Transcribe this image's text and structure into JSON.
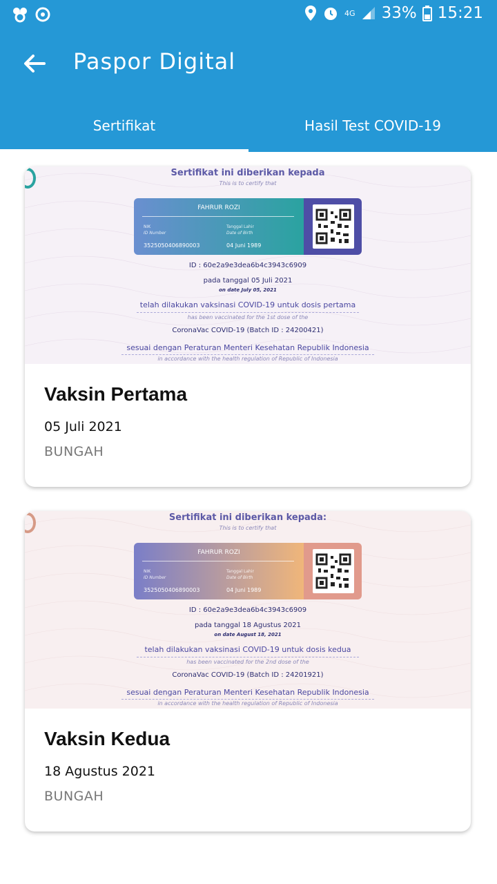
{
  "status_bar": {
    "battery": "33%",
    "time": "15:21",
    "network": "4G",
    "icons": [
      "app-notification-icon",
      "app-notification-icon-2",
      "location-icon",
      "alarm-icon",
      "signal-icon",
      "battery-icon"
    ]
  },
  "app_bar": {
    "title": "Paspor Digital"
  },
  "tabs": [
    {
      "label": "Sertifikat",
      "selected": true
    },
    {
      "label": "Hasil Test COVID-19",
      "selected": false
    }
  ],
  "colors": {
    "primary": "#2598d6",
    "card1_grad_start": "#6a8fd0",
    "card1_grad_end": "#2aa3a0",
    "card1_qr_bg": "#4e4ea6",
    "card2_grad_start": "#7a7ec8",
    "card2_grad_end": "#f0b67a",
    "card2_qr_bg": "#e19a8c"
  },
  "certificates": [
    {
      "cert_title": "Sertifikat ini diberikan kepada",
      "cert_title_en": "This is to certify that",
      "name": "FAHRUR ROZI",
      "nik_label": "NIK",
      "nik_label_en": "ID Number",
      "nik": "3525050406890003",
      "dob_label": "Tanggal Lahir",
      "dob_label_en": "Date of Birth",
      "dob": "04 Juni 1989",
      "id_line": "ID : 60e2a9e3dea6b4c3943c6909",
      "date_line": "pada tanggal 05 Juli 2021",
      "date_line_en": "on date July 05, 2021",
      "vacc_line": "telah dilakukan vaksinasi COVID-19 untuk dosis pertama",
      "vacc_line_en": "has been vaccinated for the 1st dose of the",
      "batch_line": "CoronaVac COVID-19 (Batch ID : 24200421)",
      "regulation": "sesuai dengan Peraturan Menteri Kesehatan Republik Indonesia",
      "regulation_en": "in accordance with the health regulation of Republic of Indonesia",
      "title": "Vaksin Pertama",
      "date": "05 Juli 2021",
      "location": "BUNGAH"
    },
    {
      "cert_title": "Sertifikat ini diberikan kepada:",
      "cert_title_en": "This is to certify that",
      "name": "FAHRUR ROZI",
      "nik_label": "NIK",
      "nik_label_en": "ID Number",
      "nik": "3525050406890003",
      "dob_label": "Tanggal Lahir",
      "dob_label_en": "Date of Birth",
      "dob": "04 Juni 1989",
      "id_line": "ID : 60e2a9e3dea6b4c3943c6909",
      "date_line": "pada tanggal 18 Agustus 2021",
      "date_line_en": "on date August 18, 2021",
      "vacc_line": "telah dilakukan vaksinasi COVID-19 untuk dosis kedua",
      "vacc_line_en": "has been vaccinated for the 2nd dose of the",
      "batch_line": "CoronaVac COVID-19 (Batch ID : 24201921)",
      "regulation": "sesuai dengan Peraturan Menteri Kesehatan Republik Indonesia",
      "regulation_en": "in accordance with the health regulation of Republic of Indonesia",
      "title": "Vaksin Kedua",
      "date": "18 Agustus 2021",
      "location": "BUNGAH"
    }
  ]
}
